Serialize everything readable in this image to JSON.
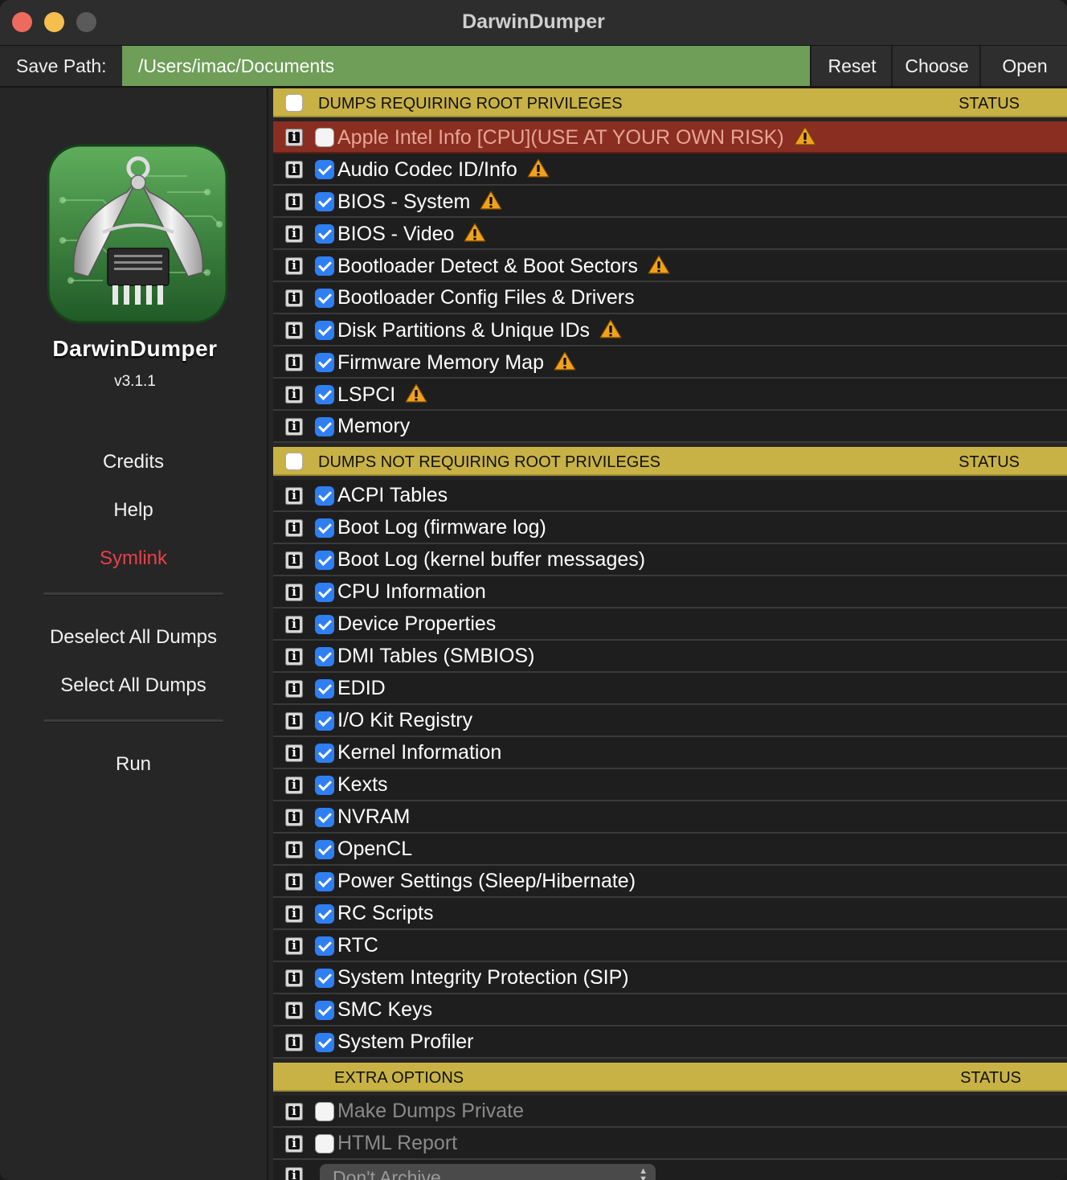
{
  "window": {
    "title": "DarwinDumper"
  },
  "pathbar": {
    "label": "Save Path:",
    "value": "/Users/imac/Documents",
    "reset": "Reset",
    "choose": "Choose",
    "open": "Open"
  },
  "sidebar": {
    "app_name": "DarwinDumper",
    "version": "v3.1.1",
    "credits": "Credits",
    "help": "Help",
    "symlink": "Symlink",
    "deselect_all": "Deselect All Dumps",
    "select_all": "Select All Dumps",
    "run": "Run"
  },
  "sections": {
    "root": {
      "title": "DUMPS REQUIRING ROOT PRIVILEGES",
      "status": "STATUS",
      "checked": false
    },
    "nonroot": {
      "title": "DUMPS NOT REQUIRING ROOT PRIVILEGES",
      "status": "STATUS",
      "checked": false
    },
    "extra": {
      "title": "EXTRA OPTIONS",
      "status": "STATUS"
    }
  },
  "root_dumps": [
    {
      "label": "Apple Intel Info [CPU](USE AT YOUR OWN RISK)",
      "checked": false,
      "warning": true,
      "danger": true
    },
    {
      "label": "Audio Codec ID/Info",
      "checked": true,
      "warning": true
    },
    {
      "label": "BIOS - System",
      "checked": true,
      "warning": true
    },
    {
      "label": "BIOS - Video",
      "checked": true,
      "warning": true
    },
    {
      "label": "Bootloader Detect & Boot Sectors",
      "checked": true,
      "warning": true
    },
    {
      "label": "Bootloader Config Files & Drivers",
      "checked": true,
      "warning": false
    },
    {
      "label": "Disk Partitions & Unique IDs",
      "checked": true,
      "warning": true
    },
    {
      "label": "Firmware Memory Map",
      "checked": true,
      "warning": true
    },
    {
      "label": "LSPCI",
      "checked": true,
      "warning": true
    },
    {
      "label": "Memory",
      "checked": true,
      "warning": false
    }
  ],
  "nonroot_dumps": [
    {
      "label": "ACPI Tables",
      "checked": true
    },
    {
      "label": "Boot Log (firmware log)",
      "checked": true
    },
    {
      "label": "Boot Log (kernel buffer messages)",
      "checked": true
    },
    {
      "label": "CPU Information",
      "checked": true
    },
    {
      "label": "Device Properties",
      "checked": true
    },
    {
      "label": "DMI Tables (SMBIOS)",
      "checked": true
    },
    {
      "label": "EDID",
      "checked": true
    },
    {
      "label": "I/O Kit Registry",
      "checked": true
    },
    {
      "label": "Kernel Information",
      "checked": true
    },
    {
      "label": "Kexts",
      "checked": true
    },
    {
      "label": "NVRAM",
      "checked": true
    },
    {
      "label": "OpenCL",
      "checked": true
    },
    {
      "label": "Power Settings (Sleep/Hibernate)",
      "checked": true
    },
    {
      "label": "RC Scripts",
      "checked": true
    },
    {
      "label": "RTC",
      "checked": true
    },
    {
      "label": "System Integrity Protection (SIP)",
      "checked": true
    },
    {
      "label": "SMC Keys",
      "checked": true
    },
    {
      "label": "System Profiler",
      "checked": true
    }
  ],
  "extra_options": [
    {
      "label": "Make Dumps Private",
      "checked": false
    },
    {
      "label": "HTML Report",
      "checked": false
    }
  ],
  "archive_select": {
    "value": "Don't Archive"
  },
  "colors": {
    "accent": "#2f7ff2",
    "path_field": "#6e9e58",
    "section_header": "#c8b246",
    "danger_row": "#8a2e22",
    "symlink": "#e8414a",
    "warning": "#f0a21d"
  },
  "icons": {
    "row_info": "info-icon",
    "row_warning": "warning-triangle-icon",
    "app_logo": "caliper-chip-logo-icon"
  }
}
